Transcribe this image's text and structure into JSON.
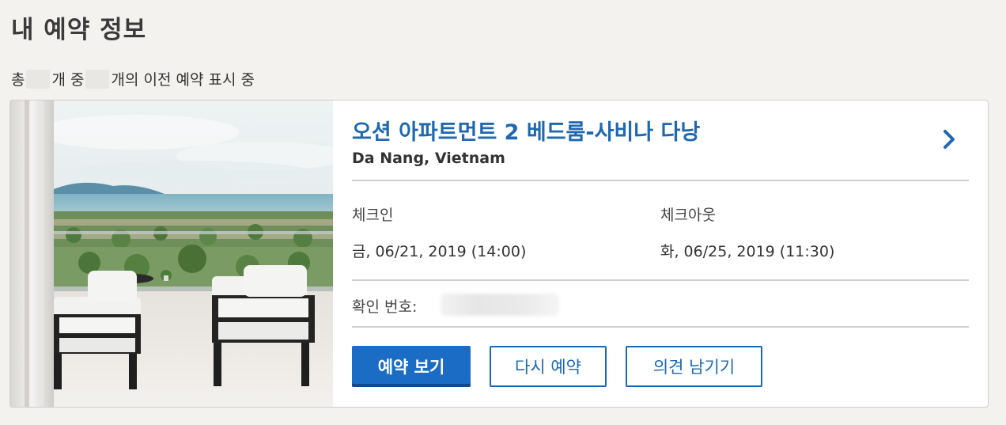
{
  "page": {
    "title": "내 예약 정보",
    "summary": {
      "prefix": "총",
      "count_unit": "개 중",
      "suffix": "개의 이전 예약 표시 중"
    }
  },
  "booking": {
    "property_name": "오션 아파트먼트 2 베드룸-사비나 다낭",
    "location": "Da Nang, Vietnam",
    "checkin_label": "체크인",
    "checkin_value": "금, 06/21, 2019 (14:00)",
    "checkout_label": "체크아웃",
    "checkout_value": "화, 06/25, 2019 (11:30)",
    "confirmation_label": "확인 번호:",
    "buttons": {
      "view": "예약 보기",
      "rebook": "다시 예약",
      "review": "의견 남기기"
    }
  },
  "icons": {
    "chevron": "chevron-right-icon"
  },
  "colors": {
    "accent": "#1f68b0",
    "primary_button": "#1b6cc4",
    "background": "#f4f2ef"
  }
}
